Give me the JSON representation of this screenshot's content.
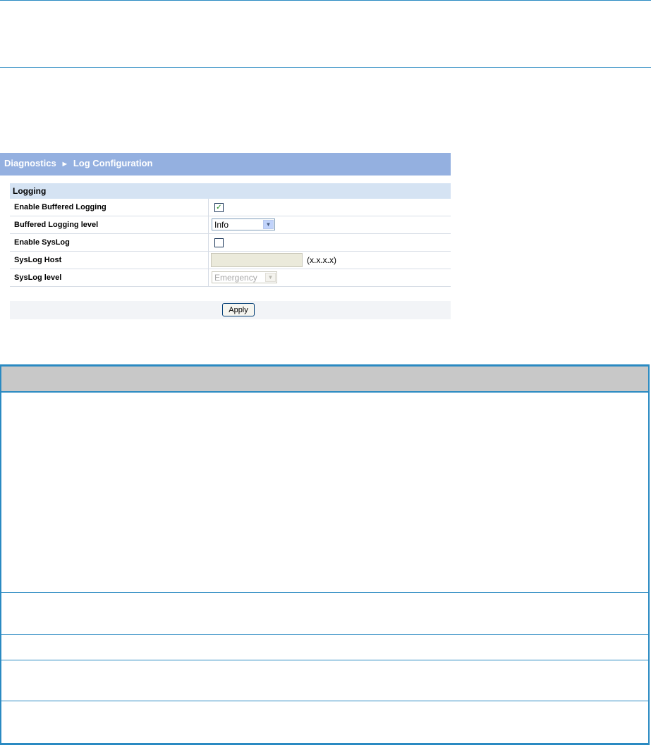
{
  "panel": {
    "breadcrumb": {
      "parent": "Diagnostics",
      "separator": "►",
      "current": "Log Configuration"
    },
    "section_title": "Logging",
    "rows": [
      {
        "label": "Enable Buffered Logging",
        "type": "checkbox",
        "checked": true,
        "mark": "✓"
      },
      {
        "label": "Buffered Logging level",
        "type": "select",
        "value": "Info",
        "disabled": false
      },
      {
        "label": "Enable SysLog",
        "type": "checkbox",
        "checked": false,
        "mark": ""
      },
      {
        "label": "SysLog Host",
        "type": "text",
        "value": "",
        "hint": "(x.x.x.x)",
        "disabled": true
      },
      {
        "label": "SysLog level",
        "type": "select",
        "value": "Emergency",
        "disabled": true
      }
    ],
    "apply_label": "Apply"
  },
  "colors": {
    "title_bar": "#94b0e0",
    "section_head": "#d5e3f3",
    "table_border": "#2a8ac2",
    "table_header": "#c8c8c8"
  }
}
